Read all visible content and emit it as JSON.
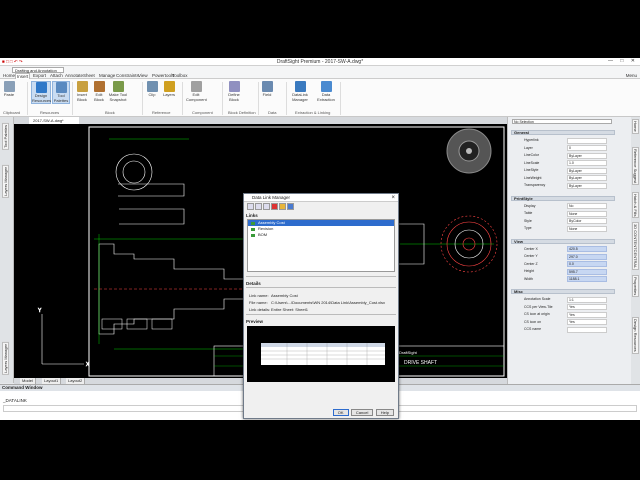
{
  "app": {
    "title": "DraftSight Premium - 2017-SW-A.dwg*",
    "workspace": "Drafting and Annotation",
    "menu_label": "Menu"
  },
  "menu_tabs": [
    "Home",
    "Insert",
    "Export",
    "Attach",
    "Annotate",
    "Sheet",
    "Manage",
    "Constraints",
    "View",
    "Powertools",
    "Toolbox"
  ],
  "active_menu_tab": "Insert",
  "ribbon": {
    "buttons": [
      {
        "label": "Paste",
        "name": "paste"
      },
      {
        "label": "Design Resources",
        "name": "design-resources"
      },
      {
        "label": "Tool Palettes",
        "name": "tool-palettes"
      },
      {
        "label": "Insert Block",
        "name": "insert-block"
      },
      {
        "label": "Edit Block",
        "name": "edit-block"
      },
      {
        "label": "Make Tool Snapshot",
        "name": "make-tool-snapshot"
      },
      {
        "label": "Clip",
        "name": "clip"
      },
      {
        "label": "Layers",
        "name": "layers"
      },
      {
        "label": "Edit Component",
        "name": "edit-component"
      },
      {
        "label": "Define Block",
        "name": "define-block"
      },
      {
        "label": "Field",
        "name": "field"
      },
      {
        "label": "DataLink Manager",
        "name": "datalink-manager"
      },
      {
        "label": "Data Extraction",
        "name": "data-extraction"
      }
    ],
    "groups": [
      "Clipboard",
      "Resources",
      "Block",
      "Reference",
      "Component",
      "Block Definition",
      "Data",
      "Extraction & Linking"
    ]
  },
  "doc_tab": "2017-SW-A.dwg*",
  "left_palette_tabs": [
    "Tool Palettes",
    "Layers Manager",
    "Layers Manager"
  ],
  "layout_tabs": [
    "Model",
    "Layout1",
    "Layout2"
  ],
  "command_window": {
    "title": "Command Window",
    "lines": [
      "_DATALINK"
    ]
  },
  "properties": {
    "selection": "No Selection",
    "sections": [
      {
        "title": "General",
        "rows": [
          {
            "label": "Hyperlink",
            "value": ""
          },
          {
            "label": "Layer",
            "value": "0"
          },
          {
            "label": "LineColor",
            "value": "ByLayer"
          },
          {
            "label": "LineScale",
            "value": "1.0"
          },
          {
            "label": "LineStyle",
            "value": "ByLayer"
          },
          {
            "label": "LineWeight",
            "value": "ByLayer"
          },
          {
            "label": "Transparency",
            "value": "ByLayer"
          }
        ]
      },
      {
        "title": "PrintStyle",
        "rows": [
          {
            "label": "Display",
            "value": "No"
          },
          {
            "label": "Table",
            "value": "None"
          },
          {
            "label": "Style",
            "value": "ByColor"
          },
          {
            "label": "Type",
            "value": "None"
          }
        ]
      },
      {
        "title": "View",
        "rows": [
          {
            "label": "Center X",
            "value": "420.5"
          },
          {
            "label": "Center Y",
            "value": "297.0"
          },
          {
            "label": "Center Z",
            "value": "0.0"
          },
          {
            "label": "Height",
            "value": "595.7"
          },
          {
            "label": "Width",
            "value": "1188.1"
          }
        ]
      },
      {
        "title": "Misc",
        "rows": [
          {
            "label": "Annotation Scale",
            "value": "1:1"
          },
          {
            "label": "CCS per View-Tile",
            "value": "Yes"
          },
          {
            "label": "CS icon at origin",
            "value": "Yes"
          },
          {
            "label": "CS icon on",
            "value": "Yes"
          },
          {
            "label": "CCS name",
            "value": ""
          }
        ]
      }
    ]
  },
  "right_tabs": [
    "Home",
    "Reference Suggest",
    "Hatch & Fills",
    "3D CONTENTCENTRAL",
    "Properties",
    "Design Resources"
  ],
  "dialog": {
    "title": "Data Link Manager",
    "links_label": "Links",
    "links": [
      "Assembly Cost",
      "Revision",
      "BOM"
    ],
    "selected": "Assembly Cost",
    "details_label": "Details",
    "details": [
      {
        "label": "Link name:",
        "value": "Assembly Cost"
      },
      {
        "label": "File name:",
        "value": "C:\\Users\\...\\Documents\\WN 2014\\Data Link\\Assembly_Cost.xlsx"
      },
      {
        "label": "Link details:",
        "value": "Entire Sheet: Sheet1"
      }
    ],
    "preview_label": "Preview",
    "buttons": {
      "ok": "OK",
      "cancel": "Cancel",
      "help": "Help"
    }
  },
  "drawing": {
    "title_block_text": "DRIVE SHAFT",
    "brand": "DraftSight"
  },
  "colors": {
    "accent": "#2e6ccd",
    "canvas": "#000000",
    "highlight": "#c7d7f2"
  }
}
